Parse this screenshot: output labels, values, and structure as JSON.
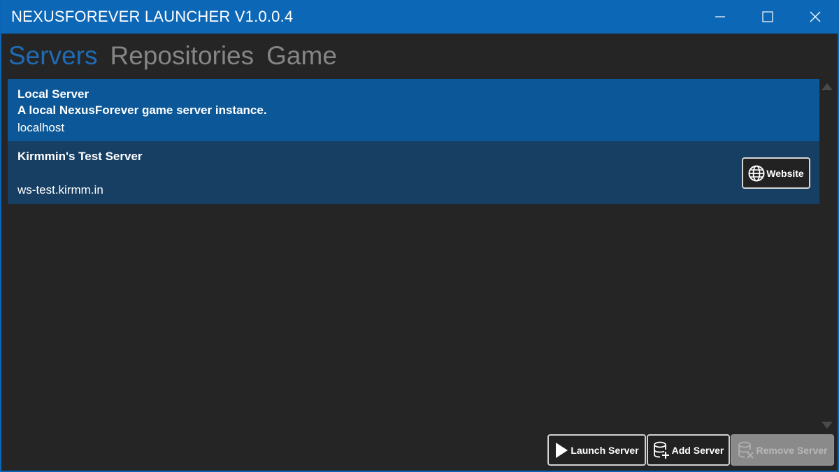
{
  "window": {
    "title": "NEXUSFOREVER LAUNCHER V1.0.0.4"
  },
  "caption_buttons": [
    "minimize",
    "maximize",
    "close"
  ],
  "tabs": [
    {
      "label": "Servers",
      "active": true
    },
    {
      "label": "Repositories",
      "active": false
    },
    {
      "label": "Game",
      "active": false
    }
  ],
  "servers": [
    {
      "name": "Local Server",
      "description": "A local NexusForever game server instance.",
      "host": "localhost",
      "selected": true
    },
    {
      "name": "Kirmmin's Test Server",
      "description": "",
      "host": "ws-test.kirmm.in",
      "selected": false,
      "website_label": "Website"
    }
  ],
  "actions": {
    "launch_label": "Launch Server",
    "add_label": "Add Server",
    "remove_label": "Remove Server",
    "remove_enabled": false
  },
  "colors": {
    "titlebar": "#0c67b7",
    "background": "#252525",
    "selected_row": "#0c5797",
    "row": "#173f63",
    "active_tab": "#1f6bb6",
    "inactive_tab": "#858585"
  },
  "icons": {
    "website": "globe-icon",
    "launch": "play-icon",
    "add": "database-add-icon",
    "remove": "database-remove-icon"
  }
}
